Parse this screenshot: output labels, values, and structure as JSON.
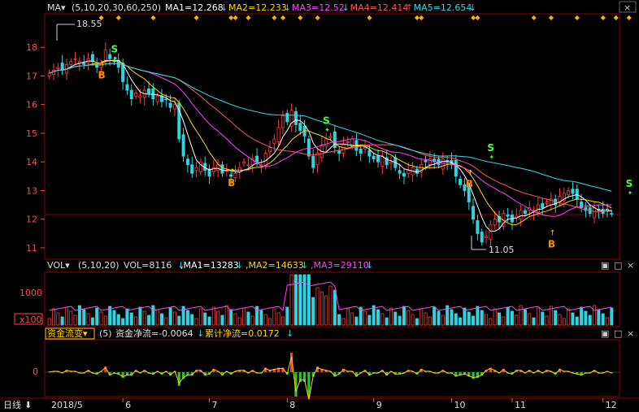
{
  "colors": {
    "bg": "#000000",
    "frame": "#8b0000",
    "grid": "#5a0000",
    "up": "#ff3b3b",
    "down": "#2fd4e0",
    "axis": "#ff4a4a",
    "ma1": "#ffffff",
    "ma2": "#ffd400",
    "ma3": "#ff44ff",
    "ma4": "#ff5555",
    "ma5": "#30d8e8",
    "signal_b": "#ff8a00",
    "signal_s": "#44ff44"
  },
  "main": {
    "indicator_label": "MA▾",
    "params": "(5,10,20,30,60,250)",
    "ma_values": [
      {
        "label": "MA1=12.268",
        "color": "#ffffff"
      },
      {
        "label": "MA2=12.233",
        "color": "#ffd400"
      },
      {
        "label": "MA3=12.52",
        "color": "#ff44ff"
      },
      {
        "label": "MA4=12.414",
        "color": "#ff5555"
      },
      {
        "label": "MA5=12.654",
        "color": "#30d8e8"
      }
    ],
    "high_label": "18.55",
    "low_label": "11.05",
    "signals": [
      {
        "type": "B",
        "date_index": 12,
        "price": 17.25
      },
      {
        "type": "S",
        "date_index": 15,
        "price": 17.6
      },
      {
        "type": "B",
        "date_index": 42,
        "price": 13.5
      },
      {
        "type": "S",
        "date_index": 64,
        "price": 15.1
      },
      {
        "type": "B",
        "date_index": 97,
        "price": 13.45
      },
      {
        "type": "S",
        "date_index": 102,
        "price": 14.15
      },
      {
        "type": "B",
        "date_index": 116,
        "price": 11.35
      },
      {
        "type": "S",
        "date_index": 134,
        "price": 12.9
      }
    ]
  },
  "vol": {
    "label": "VOL▾",
    "params": "(5,10,20)",
    "values_text": "VOL=8116",
    "ma_values": [
      {
        "label": "MA1=13283",
        "color": "#ffffff"
      },
      {
        "label": "MA2=14633",
        "color": "#ffd400"
      },
      {
        "label": "MA3=29110",
        "color": "#ff44ff"
      }
    ],
    "unit_label": "x100"
  },
  "fund": {
    "label": "资金流变▾",
    "params": "(5)",
    "net_text": "资金净流=-0.0064",
    "cum_text": "累计净流=0.0172"
  },
  "bottom": {
    "period_label": "日线",
    "months": [
      "2018/5",
      "6",
      "7",
      "8",
      "9",
      "10",
      "11",
      "12"
    ]
  },
  "chart_data": [
    {
      "type": "candlestick",
      "title": "",
      "y_ticks": [
        11,
        12,
        13,
        14,
        15,
        16,
        17,
        18
      ],
      "ylim": [
        10.8,
        18.8
      ],
      "x_axis": "trading days 2018/5 - 2018/12",
      "month_start_index": {
        "2018/5": 0,
        "6": 17,
        "7": 37,
        "8": 55,
        "9": 75,
        "10": 93,
        "11": 107,
        "12": 128
      },
      "close": [
        17.1,
        17.2,
        17.3,
        17.2,
        17.4,
        17.5,
        17.6,
        17.5,
        17.4,
        17.6,
        17.5,
        17.3,
        17.4,
        17.9,
        17.6,
        17.5,
        17.3,
        16.8,
        16.5,
        16.2,
        16.4,
        16.3,
        16.5,
        16.4,
        16.2,
        16.3,
        16.1,
        16.2,
        15.9,
        16.0,
        14.8,
        14.2,
        13.9,
        13.6,
        13.8,
        14.0,
        13.7,
        13.5,
        13.8,
        13.9,
        13.6,
        13.7,
        13.5,
        13.6,
        13.8,
        14.0,
        13.9,
        14.1,
        14.0,
        13.9,
        14.3,
        14.5,
        14.8,
        15.2,
        15.6,
        15.4,
        15.8,
        15.3,
        15.1,
        14.9,
        14.2,
        13.8,
        14.3,
        14.6,
        14.8,
        14.9,
        14.5,
        14.3,
        14.6,
        14.7,
        14.8,
        14.4,
        14.3,
        14.5,
        14.2,
        14.1,
        14.0,
        14.2,
        13.9,
        14.0,
        13.8,
        13.6,
        13.5,
        13.7,
        13.8,
        13.6,
        13.9,
        14.0,
        14.1,
        14.0,
        13.9,
        14.1,
        14.0,
        13.9,
        13.5,
        13.2,
        13.0,
        12.6,
        12.0,
        11.5,
        11.2,
        11.4,
        11.8,
        12.0,
        11.9,
        12.2,
        12.1,
        11.9,
        12.1,
        12.3,
        12.2,
        12.4,
        12.3,
        12.5,
        12.4,
        12.6,
        12.7,
        12.5,
        12.8,
        12.9,
        13.0,
        12.9,
        12.7,
        12.4,
        12.3,
        12.2,
        12.4,
        12.3,
        12.2,
        12.3,
        12.2
      ],
      "ma_lines": [
        "MA1",
        "MA2",
        "MA3",
        "MA4",
        "MA5"
      ]
    },
    {
      "type": "bar",
      "title": "VOL",
      "y_ticks": [
        1000
      ],
      "unit": "x100"
    },
    {
      "type": "bar",
      "title": "资金流变",
      "y_ticks": [
        0
      ]
    }
  ]
}
